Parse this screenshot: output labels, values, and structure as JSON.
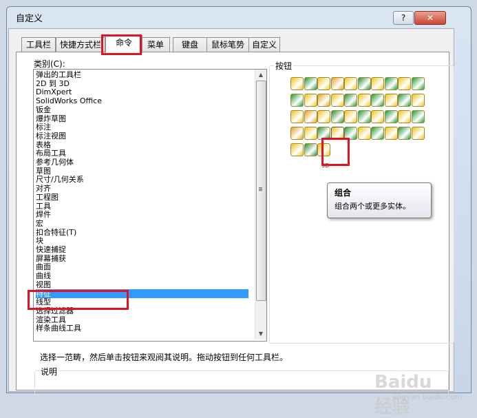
{
  "window": {
    "title": "自定义",
    "help": "?",
    "close": "✕"
  },
  "tabs": [
    {
      "label": "工具栏",
      "active": false
    },
    {
      "label": "快捷方式栏",
      "active": false
    },
    {
      "label": "命令",
      "active": true
    },
    {
      "label": "菜单",
      "active": false
    },
    {
      "label": "键盘",
      "active": false
    },
    {
      "label": "鼠标笔势",
      "active": false
    },
    {
      "label": "自定义",
      "active": false
    }
  ],
  "category": {
    "label": "类别(C):",
    "items": [
      "弹出的工具栏",
      "2D 到 3D",
      "DimXpert",
      "SolidWorks Office",
      "钣金",
      "爆炸草图",
      "标注",
      "标注视图",
      "表格",
      "布局工具",
      "参考几何体",
      "草图",
      "尺寸/几何关系",
      "对齐",
      "工程图",
      "工具",
      "焊件",
      "宏",
      "扣合特征(T)",
      "块",
      "快速捕捉",
      "屏幕捕获",
      "曲面",
      "曲线",
      "视图",
      "特征",
      "线型",
      "选择过滤器",
      "渲染工具",
      "样条曲线工具"
    ],
    "selected_index": 25
  },
  "buttons": {
    "label": "按钮",
    "extra_text": "3D"
  },
  "tooltip": {
    "title": "组合",
    "description": "组合两个或更多实体。"
  },
  "instruction": "选择一范畴，然后单击按钮来观阅其说明。拖动按钮到任何工具栏。",
  "description": {
    "label": "说明"
  },
  "watermark": {
    "main": "Baidu 经验",
    "sub": "jingyan.baidu.com"
  },
  "colors": {
    "highlight_red": "#e0141e",
    "selection_blue": "#3399ff",
    "icon_yellow": "#f2c418",
    "icon_green": "#1e9a3c"
  }
}
